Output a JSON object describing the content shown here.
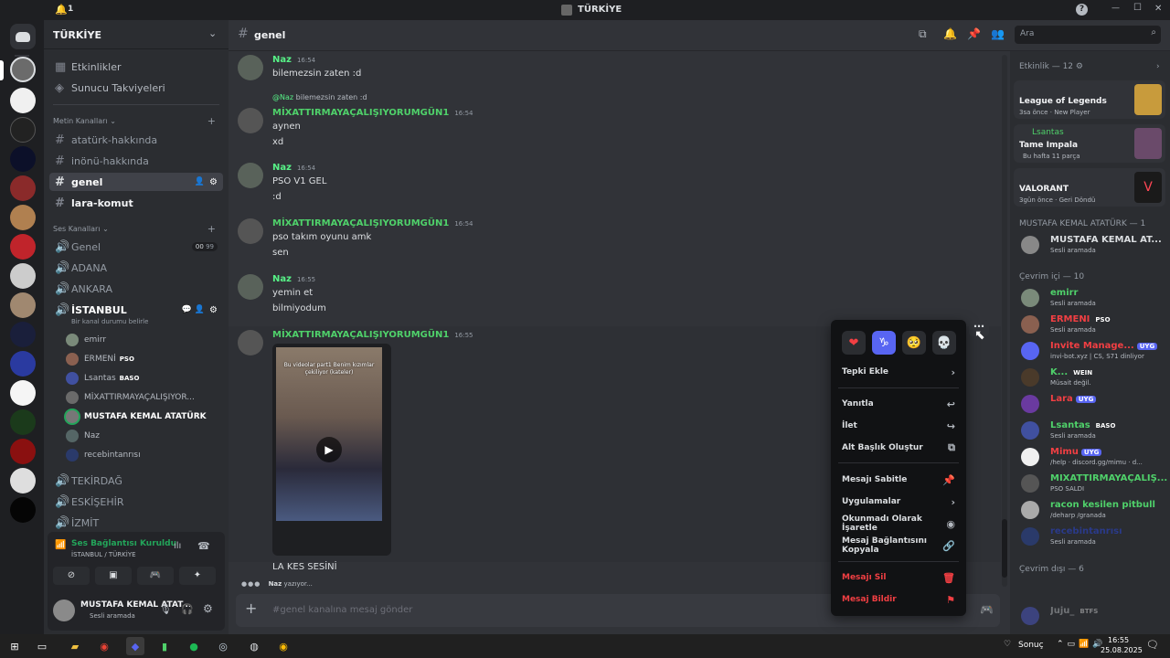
{
  "window": {
    "notif_count": "1",
    "title": "TÜRKİYE",
    "help": "?",
    "min": "—",
    "max": "☐",
    "close": "✕"
  },
  "server": {
    "name": "TÜRKİYE"
  },
  "sidebar": {
    "events": "Etkinlikler",
    "boosts": "Sunucu Takviyeleri",
    "text_header": "Metin Kanalları",
    "text_channels": [
      "atatürk-hakkında",
      "inönü-hakkında",
      "genel",
      "lara-komut"
    ],
    "voice_header": "Ses Kanalları",
    "voice_channels": {
      "genel": "Genel",
      "genel_count_a": "00",
      "genel_count_b": "99",
      "adana": "ADANA",
      "ankara": "ANKARA",
      "istanbul": "İSTANBUL",
      "istanbul_status": "Bir kanal durumu belirle",
      "tekirdag": "TEKİRDAĞ",
      "eskisehir": "ESKİŞEHİR",
      "izmit": "İZMİT"
    },
    "voice_users": [
      "emirr",
      "ERMENİ",
      "Lsantas",
      "MİXATTIRMAYAÇALIŞIYOR...",
      "MUSTAFA KEMAL ATATÜRK",
      "Naz",
      "recebintanrısı"
    ],
    "voice_tags": {
      "ermeni": "PSO",
      "lsantas": "BASO"
    }
  },
  "voice_panel": {
    "title": "Ses Bağlantısı Kuruldu",
    "subtitle": "İSTANBUL / TÜRKİYE"
  },
  "user_panel": {
    "name": "MUSTAFA KEMAL ATAT...",
    "status": "Sesli aramada"
  },
  "channel_header": {
    "name": "genel",
    "search_placeholder": "Ara"
  },
  "messages": [
    {
      "author": "Naz",
      "time": "16:54",
      "lines": [
        "bilemezsin zaten :d"
      ]
    },
    {
      "reply_to": "@Naz",
      "reply_text": "bilemezsin zaten :d",
      "author": "MİXATTIRMAYAÇALIŞIYORUMGÜN1",
      "time": "16:54",
      "lines": [
        "aynen",
        "xd"
      ]
    },
    {
      "author": "Naz",
      "time": "16:54",
      "lines": [
        "PSO V1 GEL",
        ":d"
      ]
    },
    {
      "author": "MİXATTIRMAYAÇALIŞIYORUMGÜN1",
      "time": "16:54",
      "lines": [
        "pso takım oyunu amk",
        "sen"
      ]
    },
    {
      "author": "Naz",
      "time": "16:55",
      "lines": [
        "yemin et",
        "bilmiyodum"
      ]
    },
    {
      "author": "MİXATTIRMAYAÇALIŞIYORUMGÜN1",
      "time": "16:55",
      "video_caption": "Bu videolar part1 Benim kızımlar çekiliyor (kateler)",
      "lines": [
        "LA KES SESİNİ"
      ]
    }
  ],
  "typing": {
    "user": "Naz",
    "text": "yazıyor..."
  },
  "composer": {
    "placeholder": "#genel kanalına mesaj gönder"
  },
  "context_menu": {
    "reactions": [
      "❤",
      "♑",
      "🥺",
      "💀"
    ],
    "items": [
      "Tepki Ekle",
      "Yanıtla",
      "İlet",
      "Alt Başlık Oluştur",
      "Mesajı Sabitle",
      "Uygulamalar",
      "Okunmadı Olarak İşaretle",
      "Mesaj Bağlantısını Kopyala",
      "Mesajı Sil",
      "Mesaj Bildir"
    ]
  },
  "members": {
    "activity_header": "Etkinlik — 12",
    "activities": [
      {
        "title": "League of Legends",
        "meta": "3sa önce",
        "meta2": "New Player"
      },
      {
        "user": "Lsantas",
        "title": "Tame Impala",
        "meta": "Bu hafta 11 parça"
      },
      {
        "title": "VALORANT",
        "meta": "3gün önce",
        "meta2": "Geri Döndü"
      }
    ],
    "role_header": "MUSTAFA KEMAL ATATÜRK — 1",
    "role_member": {
      "name": "MUSTAFA KEMAL AT...",
      "status": "Sesli aramada"
    },
    "online_header": "Çevrim içi — 10",
    "online": [
      {
        "name": "emirr",
        "status": "Sesli aramada"
      },
      {
        "name": "ERMENİ",
        "tag": "PSO",
        "status": "Sesli aramada"
      },
      {
        "name": "Invite Manage...",
        "tag": "UYG",
        "status": "invi-bot.xyz | CS, S71 dinliyor"
      },
      {
        "name": "K...",
        "tag": "WEIN",
        "status": "Müsait değil."
      },
      {
        "name": "Lara",
        "tag": "UYG",
        "status": ""
      },
      {
        "name": "Lsantas",
        "tag": "BASO",
        "status": "Sesli aramada"
      },
      {
        "name": "Mimu",
        "tag": "UYG",
        "status": "/help · discord.gg/mimu · d..."
      },
      {
        "name": "MİXATTIRMAYAÇALIŞ...",
        "status": "PSO SALDI"
      },
      {
        "name": "racon kesilen pitbull",
        "status": "/deharp /granada"
      },
      {
        "name": "recebintanrısı",
        "status": "Sesli aramada"
      }
    ],
    "offline_header": "Çevrim dışı — 6",
    "offline_member": {
      "name": "Juju_",
      "tag": "BTFS"
    }
  },
  "taskbar": {
    "weather": "Sonuç",
    "time": "16:55",
    "date": "25.08.2025"
  },
  "colors": {
    "green": "#4fd16a",
    "blurple": "#5865f2",
    "red": "#f23f43",
    "naz": "#57f287"
  }
}
